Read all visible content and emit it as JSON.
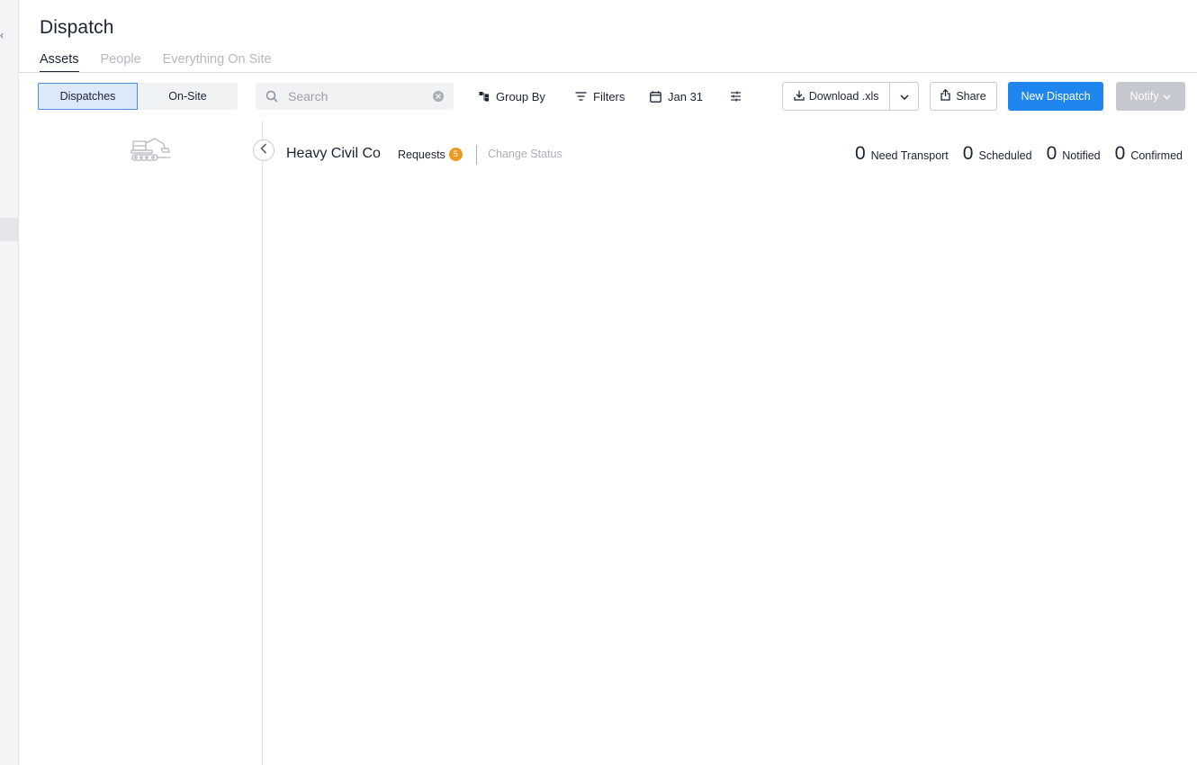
{
  "rail": {
    "collapse_glyph": "‹"
  },
  "header": {
    "title": "Dispatch",
    "tabs": [
      {
        "label": "Assets",
        "active": true
      },
      {
        "label": "People",
        "active": false
      },
      {
        "label": "Everything On Site",
        "active": false
      }
    ]
  },
  "toolbar": {
    "view_toggle": {
      "dispatches": "Dispatches",
      "on_site": "On-Site",
      "selected": "Dispatches"
    },
    "search": {
      "placeholder": "Search",
      "value": ""
    },
    "group_by": "Group By",
    "filters": "Filters",
    "date": "Jan 31",
    "download": "Download .xls",
    "share": "Share",
    "new_dispatch": "New Dispatch",
    "notify": "Notify"
  },
  "main": {
    "company": "Heavy Civil Co",
    "requests_label": "Requests",
    "requests_count": "5",
    "change_status": "Change Status",
    "stats": [
      {
        "value": "0",
        "label": "Need Transport"
      },
      {
        "value": "0",
        "label": "Scheduled"
      },
      {
        "value": "0",
        "label": "Notified"
      },
      {
        "value": "0",
        "label": "Confirmed"
      }
    ]
  },
  "colors": {
    "primary": "#1e86ee",
    "badge": "#f0981f",
    "disabled": "#c5c9cf",
    "selected_segment": "#dce9fa"
  },
  "icons": [
    "search-icon",
    "clear-icon",
    "group-by-icon",
    "filter-icon",
    "calendar-icon",
    "sliders-icon",
    "download-icon",
    "chevron-down-icon",
    "share-icon",
    "excavator-icon",
    "chevron-left-icon"
  ]
}
